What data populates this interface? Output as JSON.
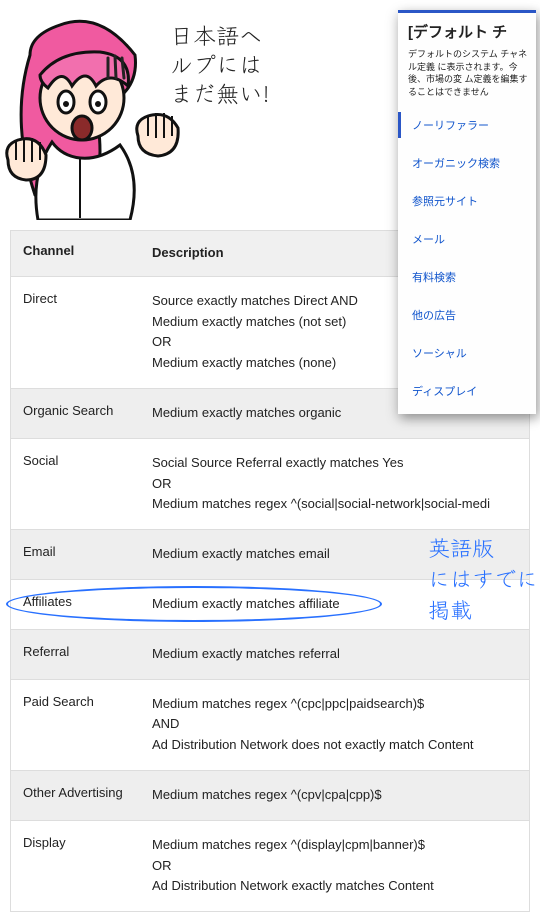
{
  "speech": {
    "line1": "日本語ヘルプには",
    "line2": "まだ無い!"
  },
  "panel": {
    "title": "[デフォルト チ",
    "subtitle": "デフォルトのシステム チャネル定義\nに表示されます。今後、市場の変\nム定義を編集することはできません",
    "items": [
      "ノーリファラー",
      "オーガニック検索",
      "参照元サイト",
      "メール",
      "有料検索",
      "他の広告",
      "ソーシャル",
      "ディスプレイ"
    ]
  },
  "tableHeaders": {
    "channel": "Channel",
    "description": "Description"
  },
  "rows": [
    {
      "channel": "Direct",
      "desc": "Source exactly matches Direct AND\nMedium exactly matches (not set)\nOR\nMedium exactly matches (none)"
    },
    {
      "channel": "Organic Search",
      "desc": "Medium exactly matches organic"
    },
    {
      "channel": "Social",
      "desc": "Social Source Referral exactly matches Yes\nOR\nMedium matches regex ^(social|social-network|social-medi"
    },
    {
      "channel": "Email",
      "desc": "Medium exactly matches email"
    },
    {
      "channel": "Affiliates",
      "desc": "Medium exactly matches affiliate"
    },
    {
      "channel": "Referral",
      "desc": "Medium exactly matches referral"
    },
    {
      "channel": "Paid Search",
      "desc": "Medium matches regex ^(cpc|ppc|paidsearch)$\nAND\nAd Distribution Network does not exactly match Content"
    },
    {
      "channel": "Other Advertising",
      "desc": "Medium matches regex ^(cpv|cpa|cpp)$"
    },
    {
      "channel": "Display",
      "desc": "Medium matches regex ^(display|cpm|banner)$\nOR\nAd Distribution Network exactly matches Content"
    }
  ],
  "sideNote": "英語版\nにはすでに\n掲載"
}
